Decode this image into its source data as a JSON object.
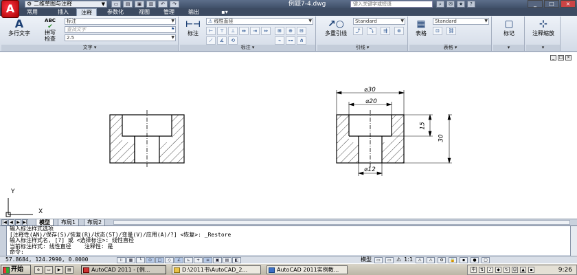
{
  "titlebar": {
    "logo": "A",
    "workspace": "二维草图与注释",
    "doc_title": "例题7-4.dwg",
    "search_placeholder": "键入关键字或短语",
    "window_buttons": {
      "minimize": "_",
      "maximize": "□",
      "close": "×"
    }
  },
  "ribbon_tabs": [
    "常用",
    "插入",
    "注释",
    "参数化",
    "视图",
    "管理",
    "输出"
  ],
  "active_tab": "注释",
  "ribbon": {
    "text_panel": {
      "title": "文字",
      "mtext_label": "多行文字",
      "spell_abc": "ABC",
      "spell_label_1": "拼写",
      "spell_label_2": "检查",
      "style_value": "标注",
      "find_placeholder": "查找文字",
      "height_value": "2.5"
    },
    "dim_panel": {
      "title": "标注",
      "dim_label": "标注",
      "dimstyle_value": "线性直径"
    },
    "leader_panel": {
      "title": "引线",
      "multileader_label": "多重引线",
      "style_value": "Standard"
    },
    "table_panel": {
      "title": "表格",
      "table_label": "表格",
      "style_value": "Standard"
    },
    "markup_panel": {
      "label": "标记"
    },
    "scale_panel": {
      "label": "注释缩放"
    }
  },
  "drawing": {
    "dim_30_dia": "⌀30",
    "dim_20_dia": "⌀20",
    "dim_12_dia": "⌀12",
    "dim_15": "15",
    "dim_30": "30",
    "ucs_y": "Y",
    "ucs_x": "X"
  },
  "layout_tabs": [
    "模型",
    "布局1",
    "布局2"
  ],
  "active_layout": "模型",
  "command_history": [
    "输入标注样式选项",
    "[注释性(AN)/保存(S)/恢复(R)/状态(ST)/变量(V)/应用(A)/?] <恢复>: _Restore",
    "输入标注样式名, [?] 或 <选择标注>: 线性直径",
    "当前标注样式: 线性直径    注释性: 是"
  ],
  "command_prompt": "命令:",
  "status": {
    "coords": "57.8684,  124.2990,  0.0000",
    "model_label": "模型",
    "annotation_scale": "1:1"
  },
  "taskbar": {
    "start_label": "开始",
    "tasks": [
      "AutoCAD 2011 - [例...",
      "D:\\2011书\\AutoCAD_2...",
      "AutoCAD 2011实例教..."
    ],
    "clock": "9:26"
  }
}
